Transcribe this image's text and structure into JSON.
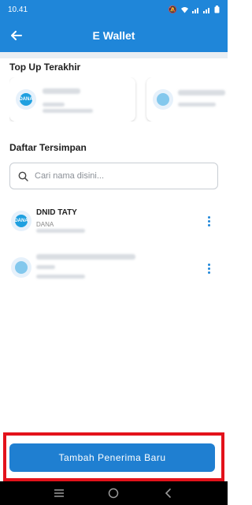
{
  "status_bar": {
    "time": "10.41"
  },
  "header": {
    "title": "E Wallet",
    "back_icon": "arrow-left-icon"
  },
  "recent": {
    "title": "Top Up Terakhir",
    "cards": [
      {
        "logo_text": "DANA"
      },
      {
        "logo_text": ""
      }
    ]
  },
  "saved": {
    "title": "Daftar Tersimpan",
    "search_placeholder": "Cari nama disini...",
    "items": [
      {
        "name": "DNID TATY",
        "sub": "DANA",
        "logo_text": "DANA"
      },
      {
        "name": "",
        "sub": "",
        "logo_text": ""
      }
    ]
  },
  "cta": {
    "label": "Tambah Penerima Baru"
  },
  "colors": {
    "primary": "#1f86d9",
    "highlight": "#e3121b"
  }
}
